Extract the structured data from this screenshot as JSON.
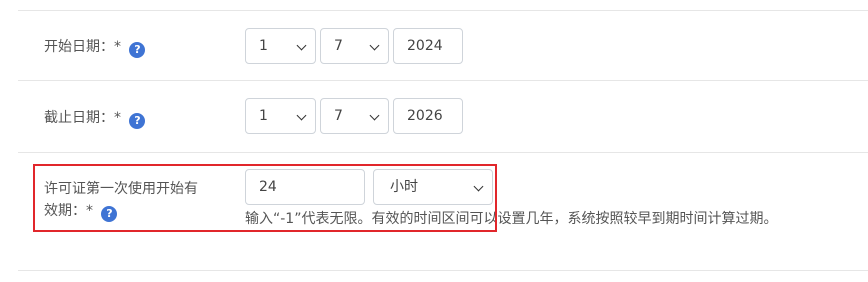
{
  "start_date": {
    "label": "开始日期：",
    "required_mark": "*",
    "help_icon": "?",
    "day": "1",
    "month": "7",
    "year": "2024"
  },
  "end_date": {
    "label": "截止日期：",
    "required_mark": "*",
    "help_icon": "?",
    "day": "1",
    "month": "7",
    "year": "2026"
  },
  "license_validity": {
    "label_line1": "许可证第一次使用开始有",
    "label_line2": "效期：",
    "required_mark": "*",
    "help_icon": "?",
    "value": "24",
    "unit": "小时",
    "hint": "输入“-1”代表无限。有效的时间区间可以设置几年，系统按照较早到期时间计算过期。"
  },
  "colors": {
    "highlight": "#e1262b",
    "help_icon": "#3f74d4"
  }
}
